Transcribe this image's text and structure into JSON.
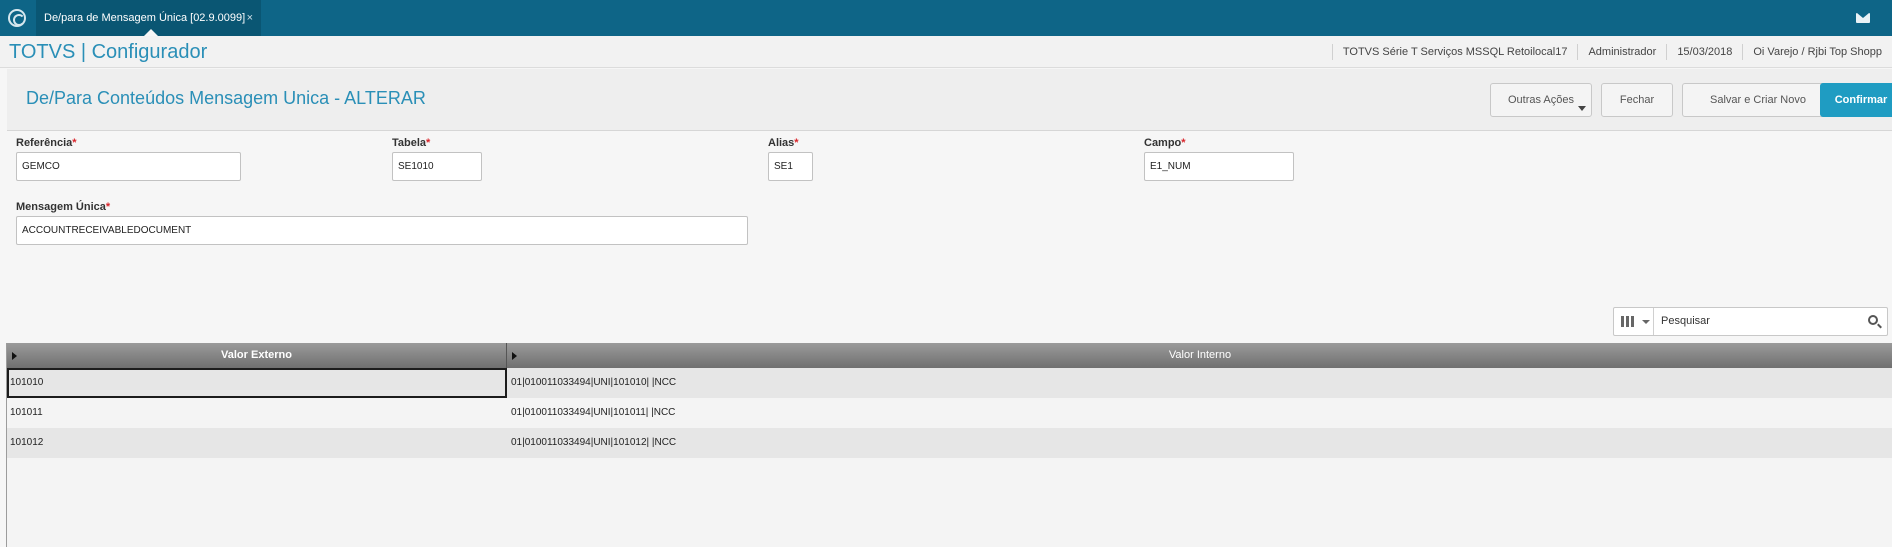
{
  "tabbar": {
    "tab_label": "De/para de Mensagem Única [02.9.0099]",
    "tab_close": "×",
    "logo_icon": "totvs-logo-icon",
    "mail_icon": "mail-icon"
  },
  "app": {
    "title": "TOTVS | Configurador",
    "info": [
      "TOTVS Série T Serviços MSSQL Retoilocal17",
      "Administrador",
      "15/03/2018",
      "Oi Varejo / Rjbi Top Shopp"
    ]
  },
  "page": {
    "title": "De/Para Conteúdos Mensagem Unica - ALTERAR",
    "buttons": {
      "outras": "Outras Ações",
      "fechar": "Fechar",
      "salvar": "Salvar e Criar Novo",
      "confirmar": "Confirmar"
    },
    "accent": "#1f9cc2"
  },
  "form": {
    "referencia": {
      "label": "Referência",
      "required": "*",
      "value": "GEMCO"
    },
    "tabela": {
      "label": "Tabela",
      "required": "*",
      "value": "SE1010"
    },
    "alias": {
      "label": "Alias",
      "required": "*",
      "value": "SE1"
    },
    "campo": {
      "label": "Campo",
      "required": "*",
      "value": "E1_NUM"
    },
    "mensagem": {
      "label": "Mensagem Única",
      "required": "*",
      "value": "ACCOUNTRECEIVABLEDOCUMENT"
    }
  },
  "search": {
    "placeholder": "Pesquisar",
    "value": "Pesquisar"
  },
  "grid": {
    "columns": [
      "Valor Externo",
      "Valor Interno"
    ],
    "rows": [
      {
        "externo": "101010",
        "interno": "01|010011033494|UNI|101010|  |NCC"
      },
      {
        "externo": "101011",
        "interno": "01|010011033494|UNI|101011|  |NCC"
      },
      {
        "externo": "101012",
        "interno": "01|010011033494|UNI|101012|  |NCC"
      }
    ]
  }
}
